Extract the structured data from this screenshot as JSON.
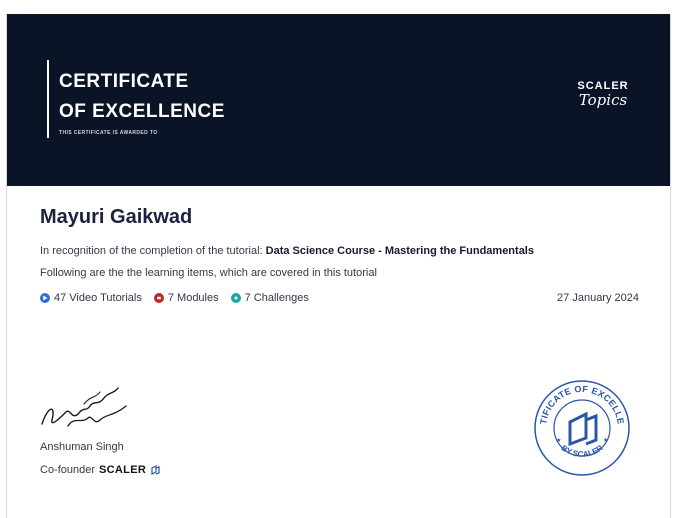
{
  "header": {
    "title_line1": "CERTIFICATE",
    "title_line2": "OF EXCELLENCE",
    "subtitle": "THIS CERTIFICATE IS AWARDED TO",
    "logo_top": "SCALER",
    "logo_bottom": "Topics"
  },
  "recipient": {
    "name": "Mayuri Gaikwad"
  },
  "body": {
    "recognition_prefix": "In recognition of the completion of the tutorial: ",
    "course": "Data Science Course - Mastering the Fundamentals",
    "items_intro": "Following are the the learning items, which are covered in this tutorial"
  },
  "items": [
    {
      "label": "47 Video Tutorials",
      "color": "#2f6fd1",
      "icon": "play-icon"
    },
    {
      "label": "7 Modules",
      "color": "#c3262b",
      "icon": "module-icon"
    },
    {
      "label": "7 Challenges",
      "color": "#1ea5a0",
      "icon": "challenge-icon"
    }
  ],
  "date": "27 January 2024",
  "signatory": {
    "name": "Anshuman Singh",
    "role_prefix": "Co-founder",
    "brand": "SCALER"
  },
  "seal": {
    "text_top": "CERTIFICATE OF EXCELLENCE",
    "text_bottom": "BY SCALER"
  },
  "colors": {
    "header_bg": "#0b1427",
    "seal_blue": "#2b56a8"
  }
}
